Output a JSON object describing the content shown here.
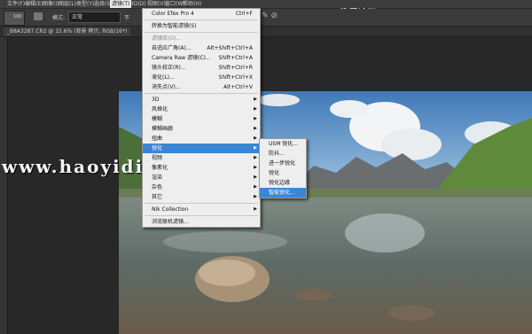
{
  "menubar": {
    "items": [
      "文件(F)",
      "编辑(E)",
      "图像(I)",
      "图层(L)",
      "类型(Y)",
      "选择(S)",
      "滤镜(T)",
      "3D(D)",
      "视图(V)",
      "窗口(W)",
      "帮助(H)"
    ],
    "active_index": 6
  },
  "watermark_top": "PS教程论坛 www.16XX8.com",
  "watermark_mid": "www.haoyidian",
  "options_bar": {
    "brush_size": "100",
    "mode_label": "模式:",
    "mode_value": "正常",
    "opacity_label": "不"
  },
  "document_tab": "_B8A3287.CR2 @ 15.6% (背景 拷贝, RGB/16*)",
  "filter_menu": {
    "items": [
      {
        "label": "Color Efex Pro 4",
        "shortcut": "Ctrl+F"
      },
      {
        "sep": true
      },
      {
        "label": "转换为智能滤镜(S)"
      },
      {
        "sep": true
      },
      {
        "label": "滤镜库(G)...",
        "disabled": true
      },
      {
        "label": "自适应广角(A)...",
        "shortcut": "Alt+Shift+Ctrl+A"
      },
      {
        "label": "Camera Raw 滤镜(C)...",
        "shortcut": "Shift+Ctrl+A"
      },
      {
        "label": "镜头校正(R)...",
        "shortcut": "Shift+Ctrl+R"
      },
      {
        "label": "液化(L)...",
        "shortcut": "Shift+Ctrl+X"
      },
      {
        "label": "消失点(V)...",
        "shortcut": "Alt+Ctrl+V"
      },
      {
        "sep": true
      },
      {
        "label": "3D",
        "submenu": true
      },
      {
        "label": "风格化",
        "submenu": true
      },
      {
        "label": "模糊",
        "submenu": true
      },
      {
        "label": "模糊画廊",
        "submenu": true
      },
      {
        "label": "扭曲",
        "submenu": true
      },
      {
        "label": "锐化",
        "submenu": true,
        "highlight": true
      },
      {
        "label": "视频",
        "submenu": true
      },
      {
        "label": "像素化",
        "submenu": true
      },
      {
        "label": "渲染",
        "submenu": true
      },
      {
        "label": "杂色",
        "submenu": true
      },
      {
        "label": "其它",
        "submenu": true
      },
      {
        "sep": true
      },
      {
        "label": "Nik Collection",
        "submenu": true
      },
      {
        "sep": true
      },
      {
        "label": "浏览联机滤镜..."
      }
    ]
  },
  "sharpen_submenu": {
    "items": [
      {
        "label": "USM 锐化..."
      },
      {
        "label": "防抖..."
      },
      {
        "label": "进一步锐化"
      },
      {
        "label": "锐化"
      },
      {
        "label": "锐化边缘"
      },
      {
        "label": "智能锐化...",
        "highlight": true
      }
    ]
  },
  "colors": {
    "menu_highlight": "#3a86d6",
    "menubar_bg": "#3c3c3c",
    "workspace_bg": "#282828"
  }
}
